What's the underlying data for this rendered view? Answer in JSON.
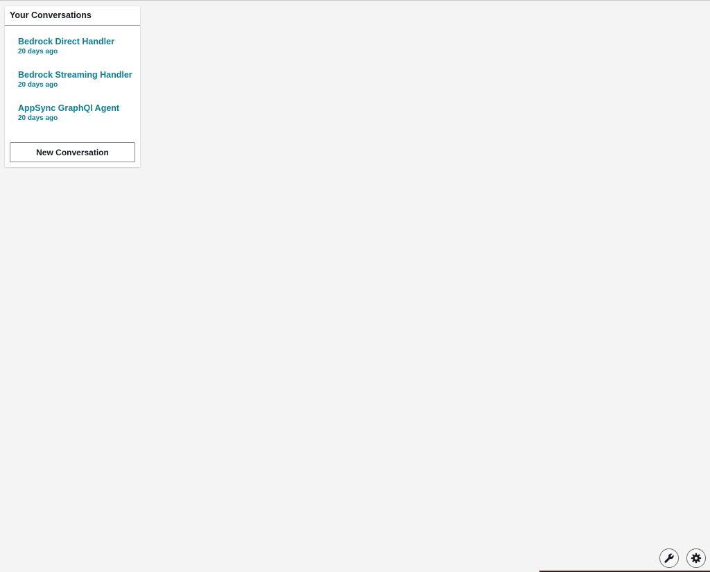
{
  "sidebar": {
    "title": "Your Conversations",
    "conversations": [
      {
        "title": "Bedrock Direct Handler",
        "time": "20 days ago"
      },
      {
        "title": "Bedrock Streaming Handler",
        "time": "20 days ago"
      },
      {
        "title": "AppSync GraphQl Agent",
        "time": "20 days ago"
      }
    ],
    "new_button_label": "New Conversation"
  },
  "floating_buttons": {
    "tools_icon": "wrench-icon",
    "settings_icon": "gear-icon"
  },
  "colors": {
    "page_background": "#f4f4f4",
    "link": "#0d7c93",
    "heading_text": "#16191f"
  }
}
